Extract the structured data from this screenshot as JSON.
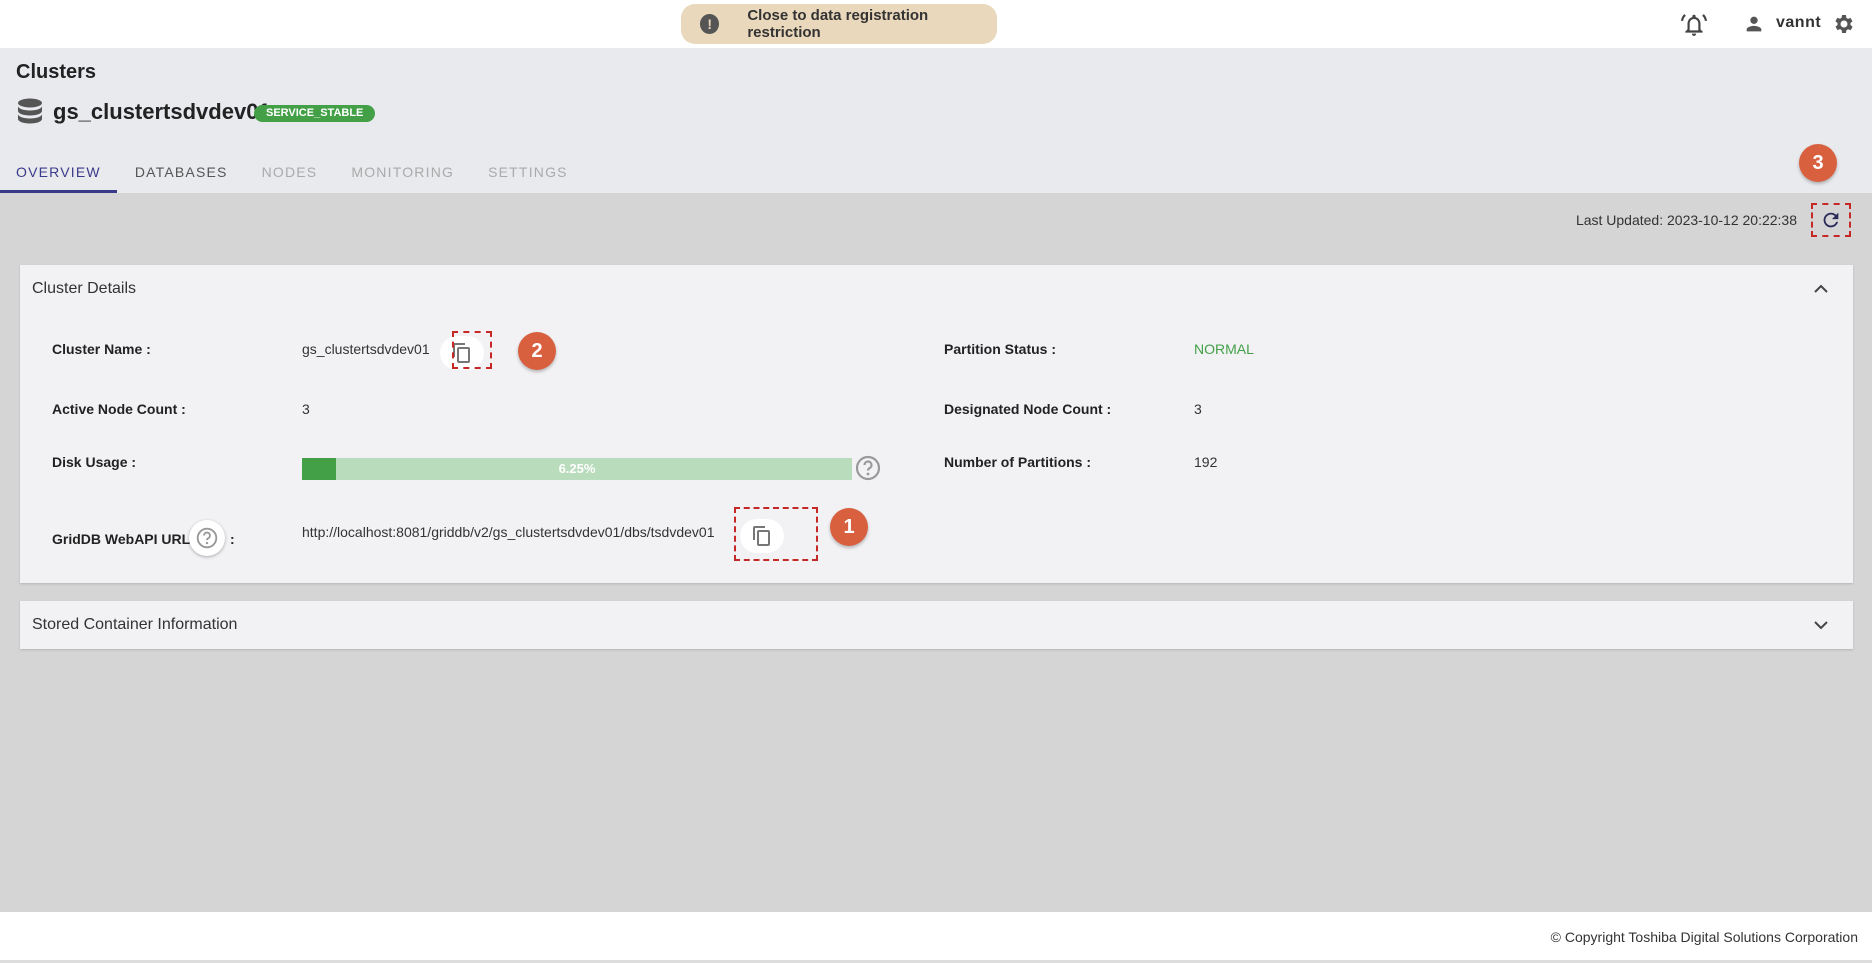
{
  "topbar": {
    "warning_text": "Close to data registration restriction",
    "username": "vannt",
    "icons": [
      "exclamation-icon",
      "bell-icon",
      "user-icon",
      "gear-icon"
    ]
  },
  "header": {
    "page_title": "Clusters",
    "cluster_name": "gs_clustertsdvdev01",
    "status": "SERVICE_STABLE",
    "tabs": [
      {
        "label": "OVERVIEW",
        "state": "active"
      },
      {
        "label": "DATABASES",
        "state": "normal"
      },
      {
        "label": "NODES",
        "state": "disabled"
      },
      {
        "label": "MONITORING",
        "state": "disabled"
      },
      {
        "label": "SETTINGS",
        "state": "disabled"
      }
    ]
  },
  "main": {
    "last_updated": "Last Updated: 2023-10-12 20:22:38",
    "markers": [
      "1",
      "2",
      "3"
    ],
    "cluster_details": {
      "title": "Cluster Details",
      "cluster_name_label": "Cluster Name :",
      "cluster_name_value": "gs_clustertsdvdev01",
      "active_node_label": "Active Node Count :",
      "active_node_value": "3",
      "disk_usage_label": "Disk Usage :",
      "disk_usage_text": "6.25%",
      "disk_usage_fraction": 0.0625,
      "webapi_label": "GridDB WebAPI URL",
      "webapi_colon": ":",
      "webapi_value": "http://localhost:8081/griddb/v2/gs_clustertsdvdev01/dbs/tsdvdev01",
      "partition_status_label": "Partition Status :",
      "partition_status_value": "NORMAL",
      "designated_node_label": "Designated Node Count :",
      "designated_node_value": "3",
      "partitions_label": "Number of Partitions :",
      "partitions_value": "192"
    },
    "stored_container": {
      "title": "Stored Container Information"
    }
  },
  "footer": {
    "copyright": "© Copyright Toshiba Digital Solutions Corporation"
  },
  "colors": {
    "accent": "#3a3a8a",
    "success": "#43a047",
    "marker": "#d9603f",
    "warning_bg": "#ead8bc"
  }
}
